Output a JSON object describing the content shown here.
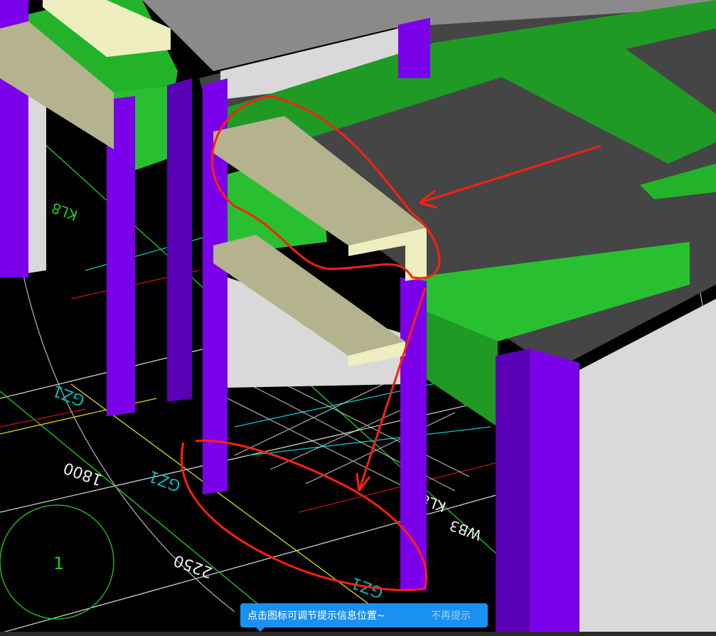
{
  "viewport": {
    "labels": {
      "col_a": "GZ1",
      "col_b": "GZ1",
      "col_c": "GZ1",
      "dim_a": "1800",
      "dim_b": "2250",
      "axis": "1",
      "beam_a": "KL8",
      "beam_b": "KL8",
      "beam_c": "WB3"
    }
  },
  "colors": {
    "column": "#7b00ea",
    "beam": "#22b32a",
    "slab": "#454545",
    "wall": "#d9d9d9",
    "tan_beam": "#b4b38d",
    "annotation": "#ff2010"
  },
  "toast": {
    "message": "点击图标可调节提示信息位置~",
    "dismiss": "不再提示"
  }
}
